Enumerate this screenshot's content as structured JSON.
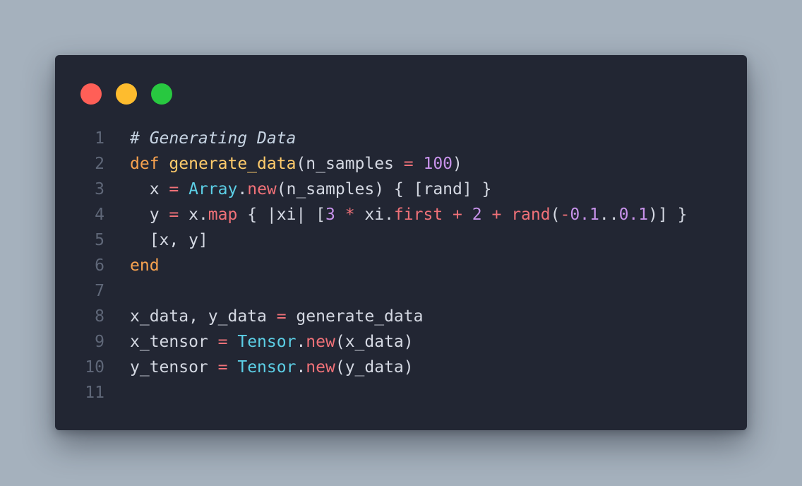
{
  "colors": {
    "background": "#a5b1bd",
    "window": "#222633",
    "close": "#ff5f57",
    "minimize": "#febc2e",
    "maximize": "#28c840",
    "line_number": "#5f6778",
    "default": "#d4d8e2",
    "comment": "#c6d3e2",
    "keyword": "#f7a24f",
    "function": "#ffcb6b",
    "number": "#c792ea",
    "operator": "#f07178",
    "method": "#f07178",
    "constant": "#5ccfe6"
  },
  "window_controls": [
    "close",
    "minimize",
    "maximize"
  ],
  "code_lines": [
    {
      "number": "1",
      "tokens": [
        {
          "text": "# Generating Data",
          "type": "comment"
        }
      ]
    },
    {
      "number": "2",
      "tokens": [
        {
          "text": "def",
          "type": "keyword"
        },
        {
          "text": " ",
          "type": "default"
        },
        {
          "text": "generate_data",
          "type": "function"
        },
        {
          "text": "(n_samples ",
          "type": "default"
        },
        {
          "text": "=",
          "type": "operator"
        },
        {
          "text": " ",
          "type": "default"
        },
        {
          "text": "100",
          "type": "number"
        },
        {
          "text": ")",
          "type": "default"
        }
      ]
    },
    {
      "number": "3",
      "tokens": [
        {
          "text": "  x ",
          "type": "default"
        },
        {
          "text": "=",
          "type": "operator"
        },
        {
          "text": " ",
          "type": "default"
        },
        {
          "text": "Array",
          "type": "constant"
        },
        {
          "text": ".",
          "type": "default"
        },
        {
          "text": "new",
          "type": "method"
        },
        {
          "text": "(n_samples) { [rand] }",
          "type": "default"
        }
      ]
    },
    {
      "number": "4",
      "tokens": [
        {
          "text": "  y ",
          "type": "default"
        },
        {
          "text": "=",
          "type": "operator"
        },
        {
          "text": " x.",
          "type": "default"
        },
        {
          "text": "map",
          "type": "method"
        },
        {
          "text": " { |xi| [",
          "type": "default"
        },
        {
          "text": "3",
          "type": "number"
        },
        {
          "text": " ",
          "type": "default"
        },
        {
          "text": "*",
          "type": "operator"
        },
        {
          "text": " xi.",
          "type": "default"
        },
        {
          "text": "first",
          "type": "method"
        },
        {
          "text": " ",
          "type": "default"
        },
        {
          "text": "+",
          "type": "operator"
        },
        {
          "text": " ",
          "type": "default"
        },
        {
          "text": "2",
          "type": "number"
        },
        {
          "text": " ",
          "type": "default"
        },
        {
          "text": "+",
          "type": "operator"
        },
        {
          "text": " ",
          "type": "default"
        },
        {
          "text": "rand",
          "type": "method"
        },
        {
          "text": "(",
          "type": "default"
        },
        {
          "text": "-",
          "type": "operator"
        },
        {
          "text": "0.1",
          "type": "number"
        },
        {
          "text": "..",
          "type": "default"
        },
        {
          "text": "0.1",
          "type": "number"
        },
        {
          "text": ")] }",
          "type": "default"
        }
      ]
    },
    {
      "number": "5",
      "tokens": [
        {
          "text": "  [x, y]",
          "type": "default"
        }
      ]
    },
    {
      "number": "6",
      "tokens": [
        {
          "text": "end",
          "type": "keyword"
        }
      ]
    },
    {
      "number": "7",
      "tokens": []
    },
    {
      "number": "8",
      "tokens": [
        {
          "text": "x_data, y_data ",
          "type": "default"
        },
        {
          "text": "=",
          "type": "operator"
        },
        {
          "text": " generate_data",
          "type": "default"
        }
      ]
    },
    {
      "number": "9",
      "tokens": [
        {
          "text": "x_tensor ",
          "type": "default"
        },
        {
          "text": "=",
          "type": "operator"
        },
        {
          "text": " ",
          "type": "default"
        },
        {
          "text": "Tensor",
          "type": "constant"
        },
        {
          "text": ".",
          "type": "default"
        },
        {
          "text": "new",
          "type": "method"
        },
        {
          "text": "(x_data)",
          "type": "default"
        }
      ]
    },
    {
      "number": "10",
      "tokens": [
        {
          "text": "y_tensor ",
          "type": "default"
        },
        {
          "text": "=",
          "type": "operator"
        },
        {
          "text": " ",
          "type": "default"
        },
        {
          "text": "Tensor",
          "type": "constant"
        },
        {
          "text": ".",
          "type": "default"
        },
        {
          "text": "new",
          "type": "method"
        },
        {
          "text": "(y_data)",
          "type": "default"
        }
      ]
    },
    {
      "number": "11",
      "tokens": []
    }
  ]
}
